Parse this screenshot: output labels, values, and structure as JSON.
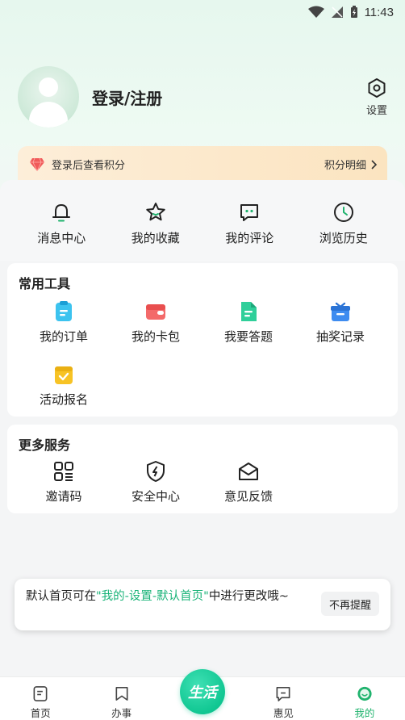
{
  "status_bar": {
    "time": "11:43"
  },
  "profile": {
    "login_label": "登录/注册",
    "settings_label": "设置"
  },
  "points": {
    "hint": "登录后查看积分",
    "detail_label": "积分明细"
  },
  "quick_actions": [
    {
      "label": "消息中心",
      "icon": "bell-icon"
    },
    {
      "label": "我的收藏",
      "icon": "star-icon"
    },
    {
      "label": "我的评论",
      "icon": "comment-icon"
    },
    {
      "label": "浏览历史",
      "icon": "clock-icon"
    }
  ],
  "tools": {
    "title": "常用工具",
    "items": [
      {
        "label": "我的订单",
        "icon": "clipboard-icon"
      },
      {
        "label": "我的卡包",
        "icon": "wallet-icon"
      },
      {
        "label": "我要答题",
        "icon": "document-icon"
      },
      {
        "label": "抽奖记录",
        "icon": "gift-icon"
      },
      {
        "label": "活动报名",
        "icon": "calendar-check-icon"
      }
    ]
  },
  "services": {
    "title": "更多服务",
    "items": [
      {
        "label": "邀请码",
        "icon": "grid-icon"
      },
      {
        "label": "安全中心",
        "icon": "shield-icon"
      },
      {
        "label": "意见反馈",
        "icon": "envelope-icon"
      }
    ]
  },
  "toast": {
    "text_before": "默认首页可在",
    "text_highlight": "\"我的-设置-默认首页\"",
    "text_after": "中进行更改哦~",
    "button_label": "不再提醒"
  },
  "tabbar": {
    "items": [
      {
        "label": "首页",
        "icon": "home-doc-icon"
      },
      {
        "label": "办事",
        "icon": "bookmark-icon"
      },
      {
        "label": "惠见",
        "icon": "chat-icon"
      },
      {
        "label": "我的",
        "icon": "face-icon"
      }
    ],
    "center_label": "生活"
  },
  "colors": {
    "accent": "#20b36e",
    "highlight": "#19b378",
    "banner": "#fbe4c0"
  }
}
